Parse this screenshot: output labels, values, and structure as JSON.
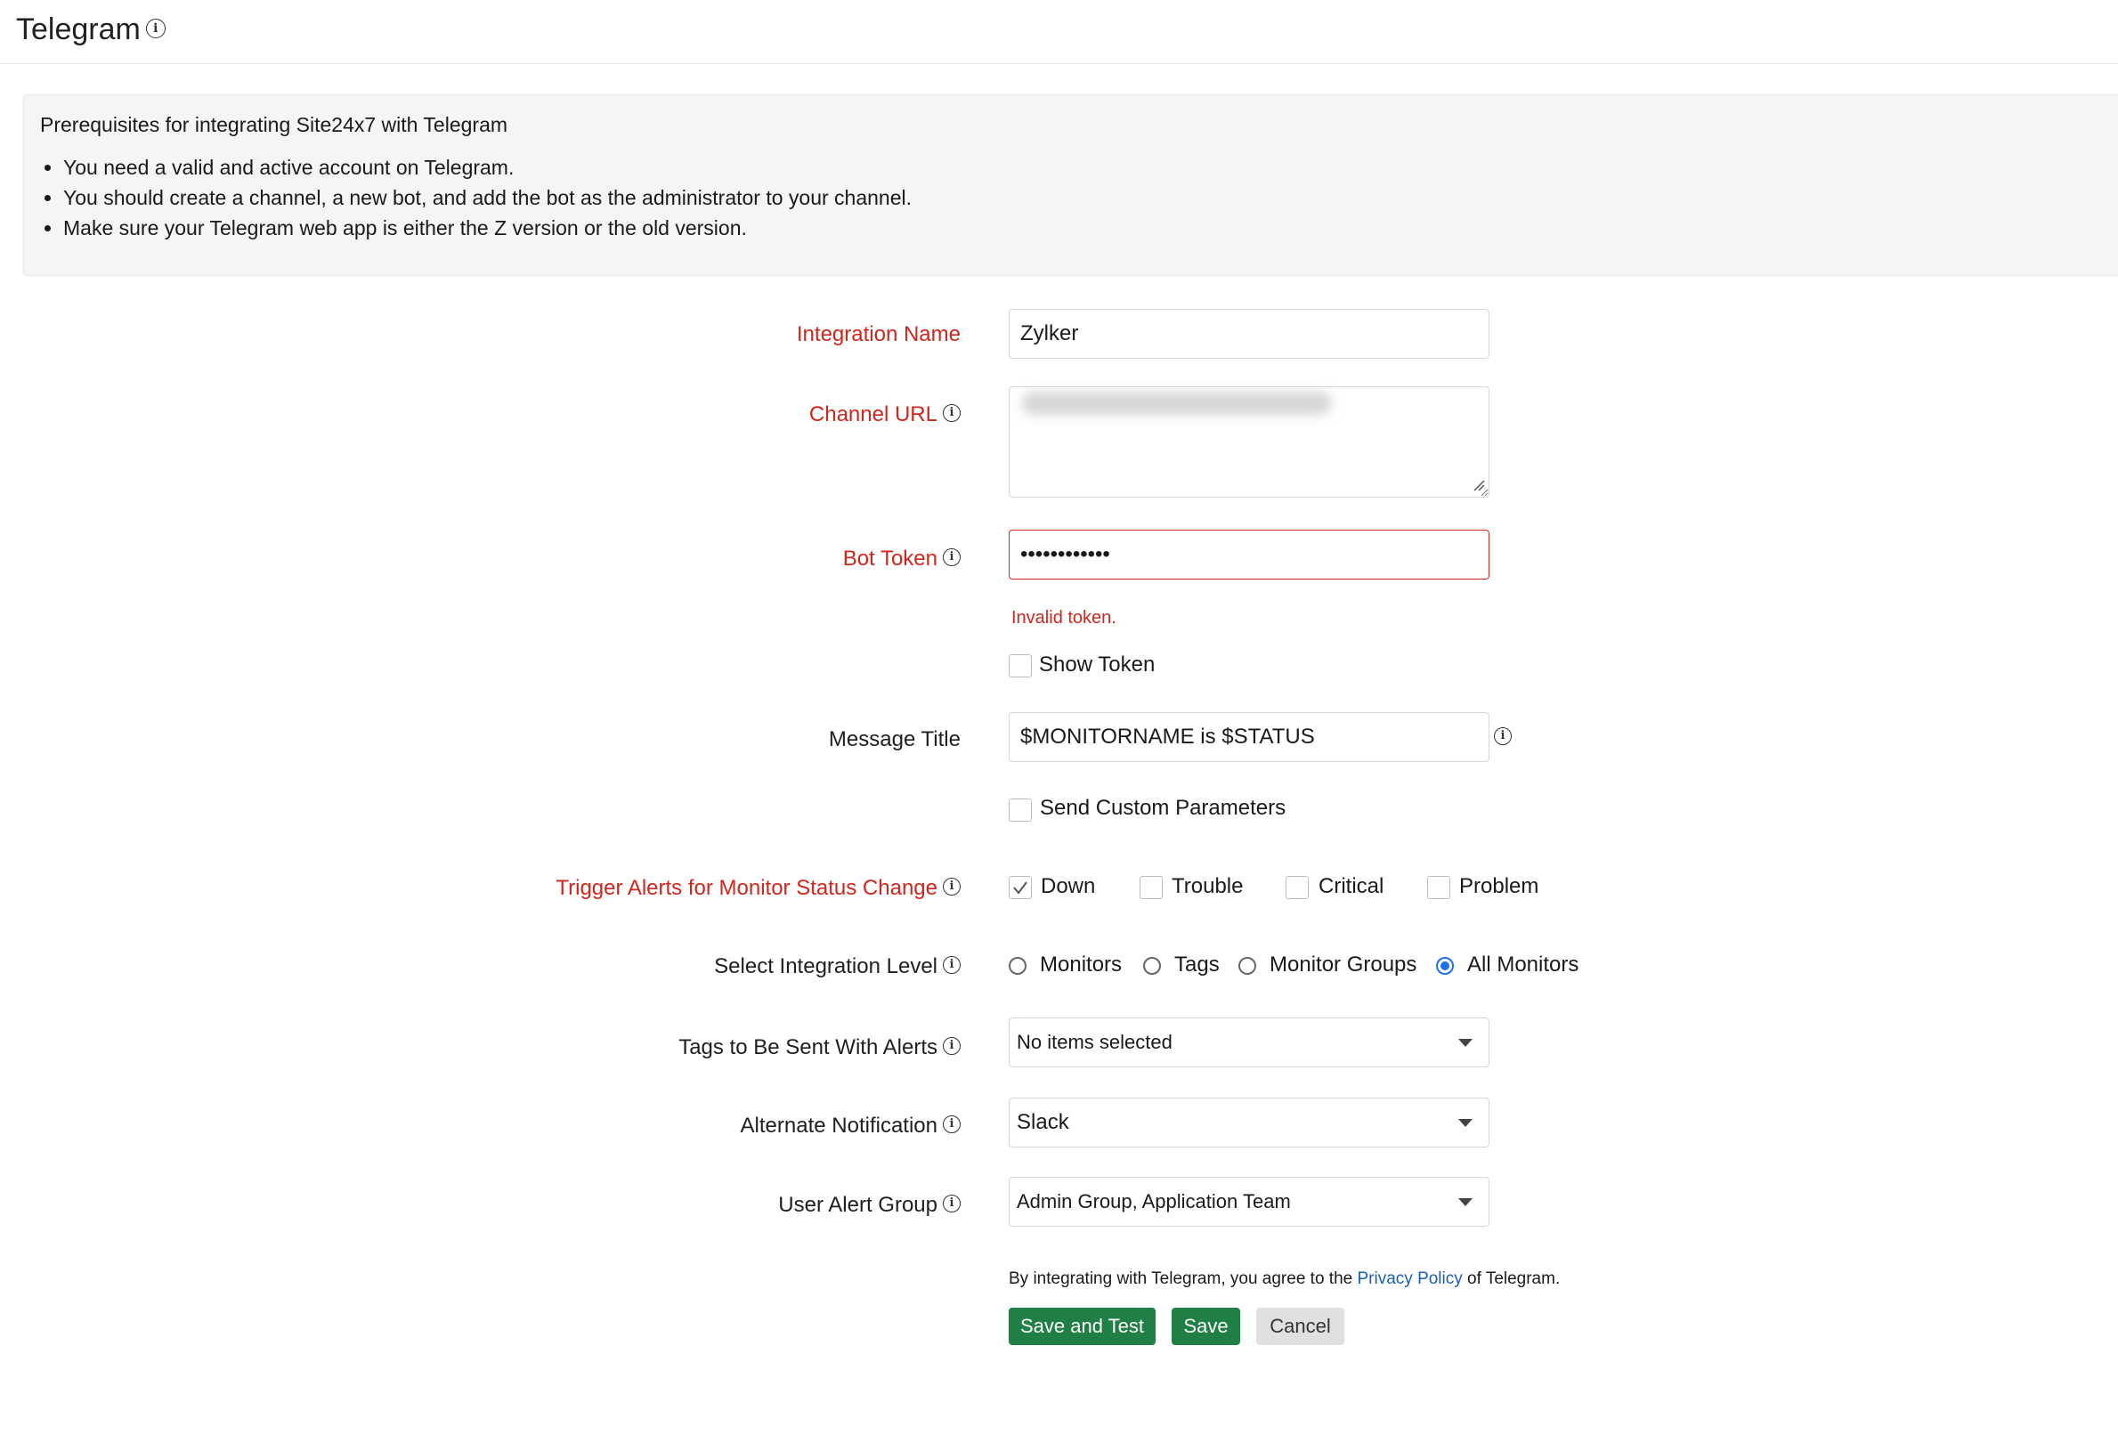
{
  "header": {
    "title": "Telegram"
  },
  "prerequisites": {
    "title": "Prerequisites for integrating Site24x7 with Telegram",
    "items": [
      "You need a valid and active account on Telegram.",
      "You should create a channel, a new bot, and add the bot as the administrator to your channel.",
      "Make sure your Telegram web app is either the Z version or the old version."
    ]
  },
  "form": {
    "integration_name": {
      "label": "Integration Name",
      "value": "Zylker"
    },
    "channel_url": {
      "label": "Channel URL"
    },
    "bot_token": {
      "label": "Bot Token",
      "value": "••••••••••••",
      "error": "Invalid token.",
      "show_token_label": "Show Token"
    },
    "message_title": {
      "label": "Message Title",
      "value": "$MONITORNAME is $STATUS",
      "send_custom_label": "Send Custom Parameters"
    },
    "trigger_alerts": {
      "label": "Trigger Alerts for Monitor Status Change",
      "options": [
        {
          "label": "Down",
          "checked": true
        },
        {
          "label": "Trouble",
          "checked": false
        },
        {
          "label": "Critical",
          "checked": false
        },
        {
          "label": "Problem",
          "checked": false
        }
      ]
    },
    "integration_level": {
      "label": "Select Integration Level",
      "options": [
        "Monitors",
        "Tags",
        "Monitor Groups",
        "All Monitors"
      ],
      "selected": "All Monitors"
    },
    "tags": {
      "label": "Tags to Be Sent With Alerts",
      "value": "No items selected"
    },
    "alternate_notification": {
      "label": "Alternate Notification",
      "value": "Slack"
    },
    "user_alert_group": {
      "label": "User Alert Group",
      "value": "Admin Group, Application Team"
    }
  },
  "consent": {
    "prefix": "By integrating with Telegram, you agree to the",
    "link": "Privacy Policy",
    "suffix": "of Telegram."
  },
  "buttons": {
    "save_and_test": "Save and Test",
    "save": "Save",
    "cancel": "Cancel"
  },
  "colors": {
    "required_label": "#d0261e",
    "primary_button": "#1f7f45",
    "radio_selected": "#1a73e8",
    "link": "#1a5fb4"
  }
}
